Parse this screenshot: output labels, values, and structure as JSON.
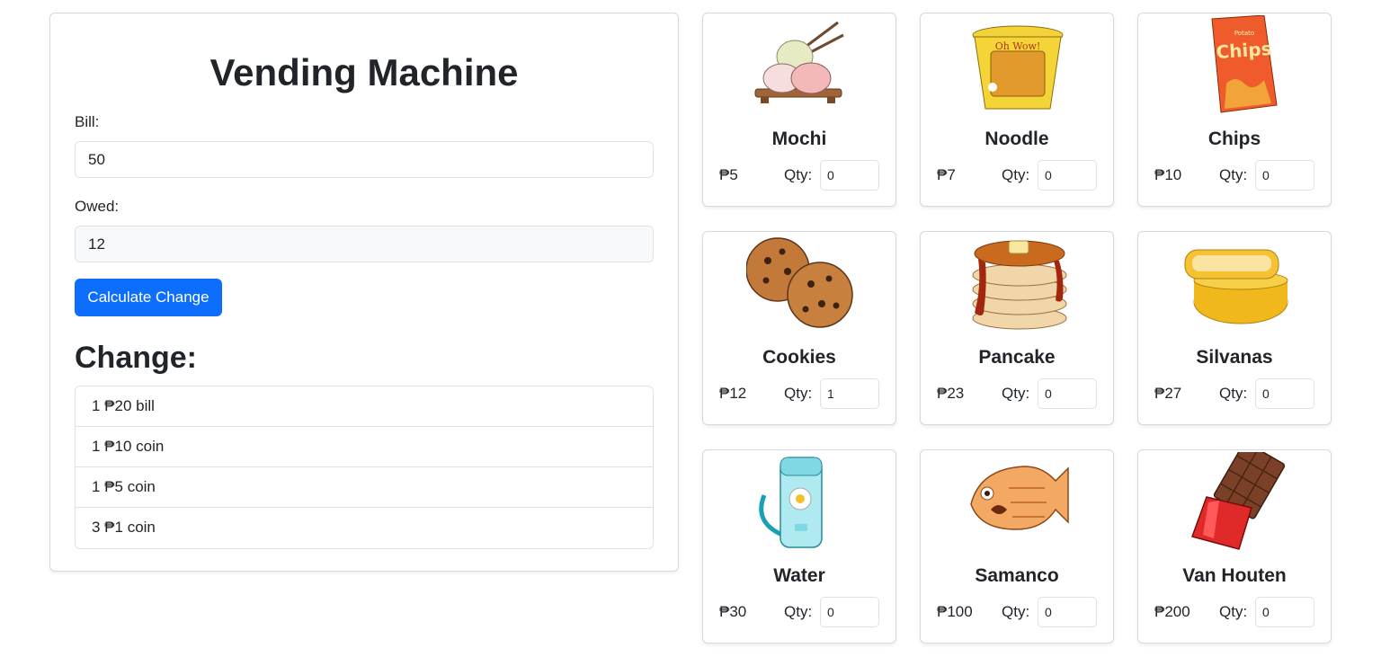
{
  "header": {
    "title": "Vending Machine"
  },
  "form": {
    "bill_label": "Bill:",
    "bill_value": "50",
    "owed_label": "Owed:",
    "owed_value": "12",
    "calculate_label": "Calculate Change"
  },
  "change": {
    "heading": "Change:",
    "items": [
      "1 ₱20 bill",
      "1 ₱10 coin",
      "1 ₱5 coin",
      "3 ₱1 coin"
    ]
  },
  "qty_label": "Qty:",
  "products": [
    {
      "name": "Mochi",
      "price": "₱5",
      "qty": "0",
      "icon": "mochi-icon"
    },
    {
      "name": "Noodle",
      "price": "₱7",
      "qty": "0",
      "icon": "noodle-cup-icon"
    },
    {
      "name": "Chips",
      "price": "₱10",
      "qty": "0",
      "icon": "chips-bag-icon"
    },
    {
      "name": "Cookies",
      "price": "₱12",
      "qty": "1",
      "icon": "cookies-icon"
    },
    {
      "name": "Pancake",
      "price": "₱23",
      "qty": "0",
      "icon": "pancake-icon"
    },
    {
      "name": "Silvanas",
      "price": "₱27",
      "qty": "0",
      "icon": "silvanas-icon"
    },
    {
      "name": "Water",
      "price": "₱30",
      "qty": "0",
      "icon": "water-bottle-icon"
    },
    {
      "name": "Samanco",
      "price": "₱100",
      "qty": "0",
      "icon": "taiyaki-fish-icon"
    },
    {
      "name": "Van Houten",
      "price": "₱200",
      "qty": "0",
      "icon": "chocolate-bar-icon"
    }
  ],
  "art_text": {
    "chips_brand": "Chips",
    "chips_top": "Potato",
    "noodle_brand": "Oh Wow!"
  },
  "colors": {
    "primary": "#0d6efd",
    "border": "#dee2e6"
  }
}
